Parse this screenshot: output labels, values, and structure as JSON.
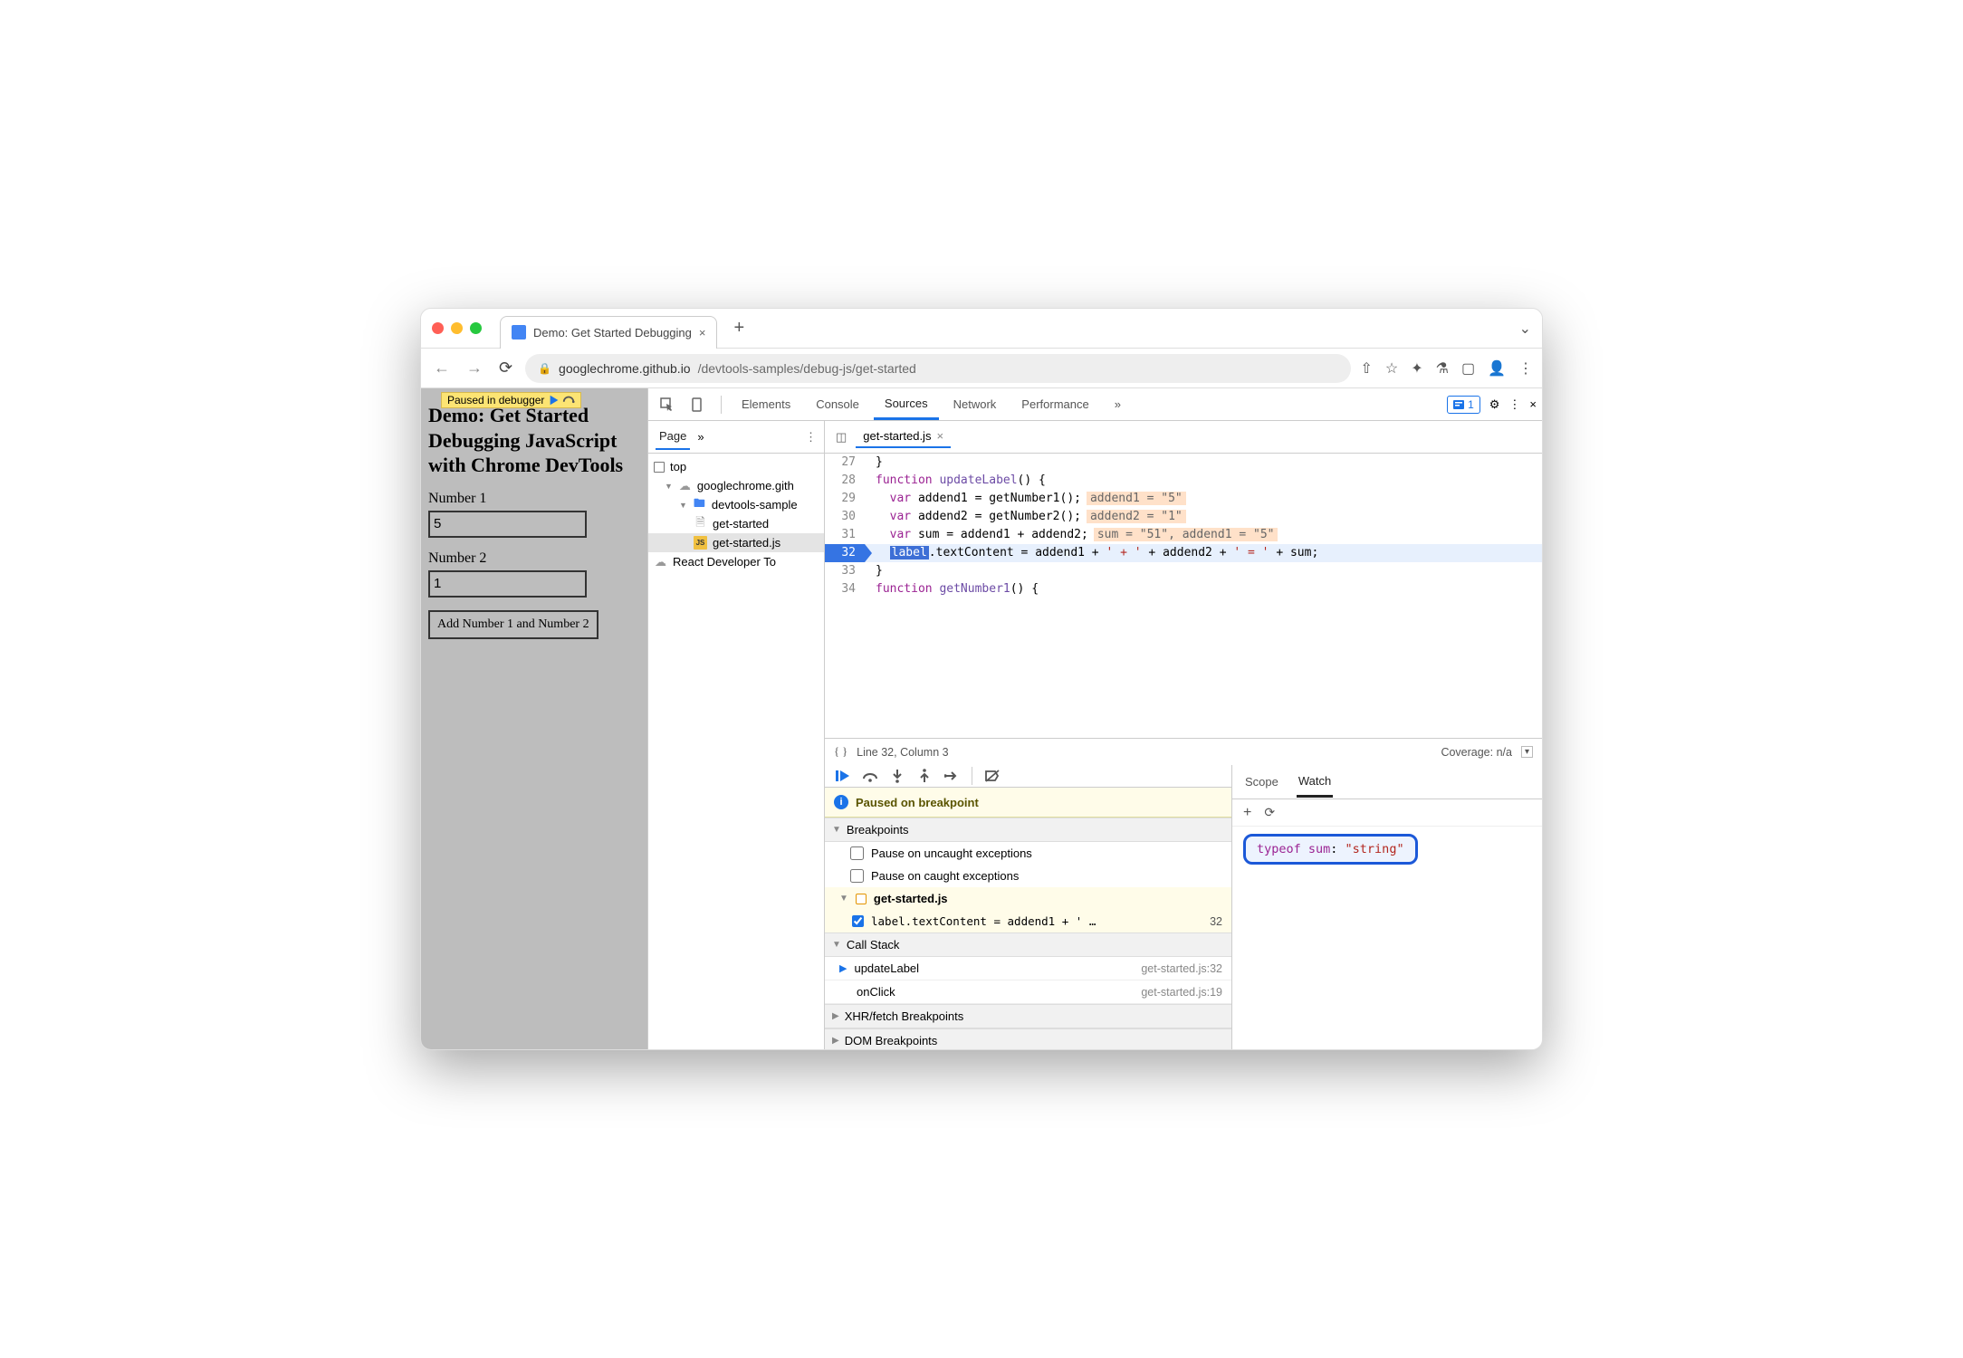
{
  "browser": {
    "tab_title": "Demo: Get Started Debugging",
    "url_host": "googlechrome.github.io",
    "url_path": "/devtools-samples/debug-js/get-started"
  },
  "paused_badge": "Paused in debugger",
  "page": {
    "heading": "Demo: Get Started Debugging JavaScript with Chrome DevTools",
    "num1_label": "Number 1",
    "num1_value": "5",
    "num2_label": "Number 2",
    "num2_value": "1",
    "add_button": "Add Number 1 and Number 2"
  },
  "devtools": {
    "tabs": [
      "Elements",
      "Console",
      "Sources",
      "Network",
      "Performance"
    ],
    "active_tab": "Sources",
    "issues_count": "1",
    "filepane": {
      "tab": "Page",
      "tree": {
        "top": "top",
        "host": "googlechrome.gith",
        "folder": "devtools-sample",
        "file_html": "get-started",
        "file_js": "get-started.js",
        "ext": "React Developer To"
      }
    },
    "editor": {
      "file_tab": "get-started.js",
      "lines": [
        {
          "n": "27",
          "t": "}"
        },
        {
          "n": "28",
          "t_kw": "function",
          "t_fn": " updateLabel",
          "t_tail": "() {"
        },
        {
          "n": "29",
          "indent": "  ",
          "t_kw": "var",
          "t": " addend1 = getNumber1();",
          "hint": "addend1 = \"5\""
        },
        {
          "n": "30",
          "indent": "  ",
          "t_kw": "var",
          "t": " addend2 = getNumber2();",
          "hint": "addend2 = \"1\""
        },
        {
          "n": "31",
          "indent": "  ",
          "t_kw": "var",
          "t": " sum = addend1 + addend2;",
          "hint": "sum = \"51\", addend1 = \"5\""
        },
        {
          "n": "32",
          "bp": true,
          "exec": true,
          "indent": "  ",
          "label": "label",
          "t1": ".textContent = addend1 + ",
          "s1": "' + '",
          "t2": " + addend2 + ",
          "s2": "' = '",
          "t3": " + sum;"
        },
        {
          "n": "33",
          "t": "}"
        },
        {
          "n": "34",
          "t_kw": "function",
          "t_fn": " getNumber1",
          "t_tail": "() {"
        }
      ],
      "footer": "Line 32, Column 3",
      "coverage": "Coverage: n/a"
    },
    "debugger": {
      "paused_msg": "Paused on breakpoint",
      "bp_section": "Breakpoints",
      "bp_uncaught": "Pause on uncaught exceptions",
      "bp_caught": "Pause on caught exceptions",
      "bp_file": "get-started.js",
      "bp_code": "label.textContent = addend1 + ' …",
      "bp_line": "32",
      "cs_section": "Call Stack",
      "cs1_name": "updateLabel",
      "cs1_src": "get-started.js:32",
      "cs2_name": "onClick",
      "cs2_src": "get-started.js:19",
      "xhr_section": "XHR/fetch Breakpoints",
      "dom_section": "DOM Breakpoints"
    },
    "watch": {
      "scope_tab": "Scope",
      "watch_tab": "Watch",
      "expr_name": "typeof sum",
      "expr_value": "\"string\""
    }
  }
}
